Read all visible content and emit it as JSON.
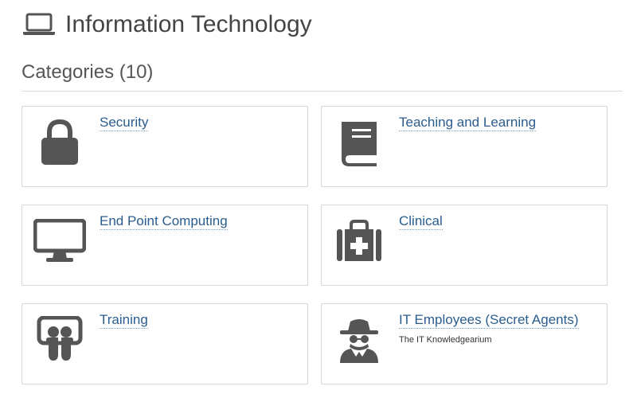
{
  "header": {
    "title": "Information Technology",
    "icon": "laptop-icon"
  },
  "section": {
    "title": "Categories (10)"
  },
  "categories": [
    {
      "name": "Security",
      "icon": "lock-icon",
      "description": ""
    },
    {
      "name": "Teaching and Learning",
      "icon": "book-icon",
      "description": ""
    },
    {
      "name": "End Point Computing",
      "icon": "desktop-icon",
      "description": ""
    },
    {
      "name": "Clinical",
      "icon": "medkit-icon",
      "description": ""
    },
    {
      "name": "Training",
      "icon": "slideshare-icon",
      "description": ""
    },
    {
      "name": "IT Employees (Secret Agents)",
      "icon": "spy-icon",
      "description": "The IT Knowledgearium"
    }
  ],
  "colors": {
    "link": "#2a5d8f",
    "icon": "#555555",
    "title": "#444444"
  }
}
